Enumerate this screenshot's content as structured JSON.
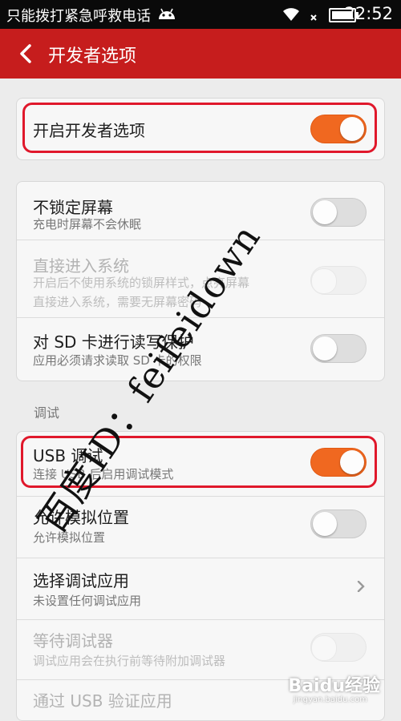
{
  "status_bar": {
    "carrier": "只能拨打紧急呼救电话",
    "time": "22:52"
  },
  "action_bar": {
    "title": "开发者选项"
  },
  "master": {
    "title": "开启开发者选项",
    "toggle": "on"
  },
  "group1": [
    {
      "title": "不锁定屏幕",
      "subtitle": "充电时屏幕不会休眠",
      "toggle": "off"
    },
    {
      "title": "直接进入系统",
      "subtitle_line1": "开启后不使用系统的锁屏样式，点亮屏幕",
      "subtitle_line2": "直接进入系统，需要无屏幕密码",
      "toggle": "disabled"
    },
    {
      "title": "对 SD 卡进行读写保护",
      "subtitle": "应用必须请求读取 SD 卡的权限",
      "toggle": "off"
    }
  ],
  "section_debug": "调试",
  "group2": [
    {
      "title": "USB 调试",
      "subtitle": "连接 USB 后启用调试模式",
      "toggle": "on"
    },
    {
      "title": "允许模拟位置",
      "subtitle": "允许模拟位置",
      "toggle": "off"
    },
    {
      "title": "选择调试应用",
      "subtitle": "未设置任何调试应用",
      "control": "chevron"
    },
    {
      "title": "等待调试器",
      "subtitle": "调试应用会在执行前等待附加调试器",
      "toggle": "disabled"
    },
    {
      "title": "通过 USB 验证应用"
    }
  ],
  "watermark": "百度ID：feifeidown",
  "logo": {
    "text": "Baidu经验",
    "sub": "jingyan.baidu.com"
  },
  "colors": {
    "accent": "#c61d1d",
    "toggle_on": "#f06820",
    "highlight": "#e0182b"
  }
}
